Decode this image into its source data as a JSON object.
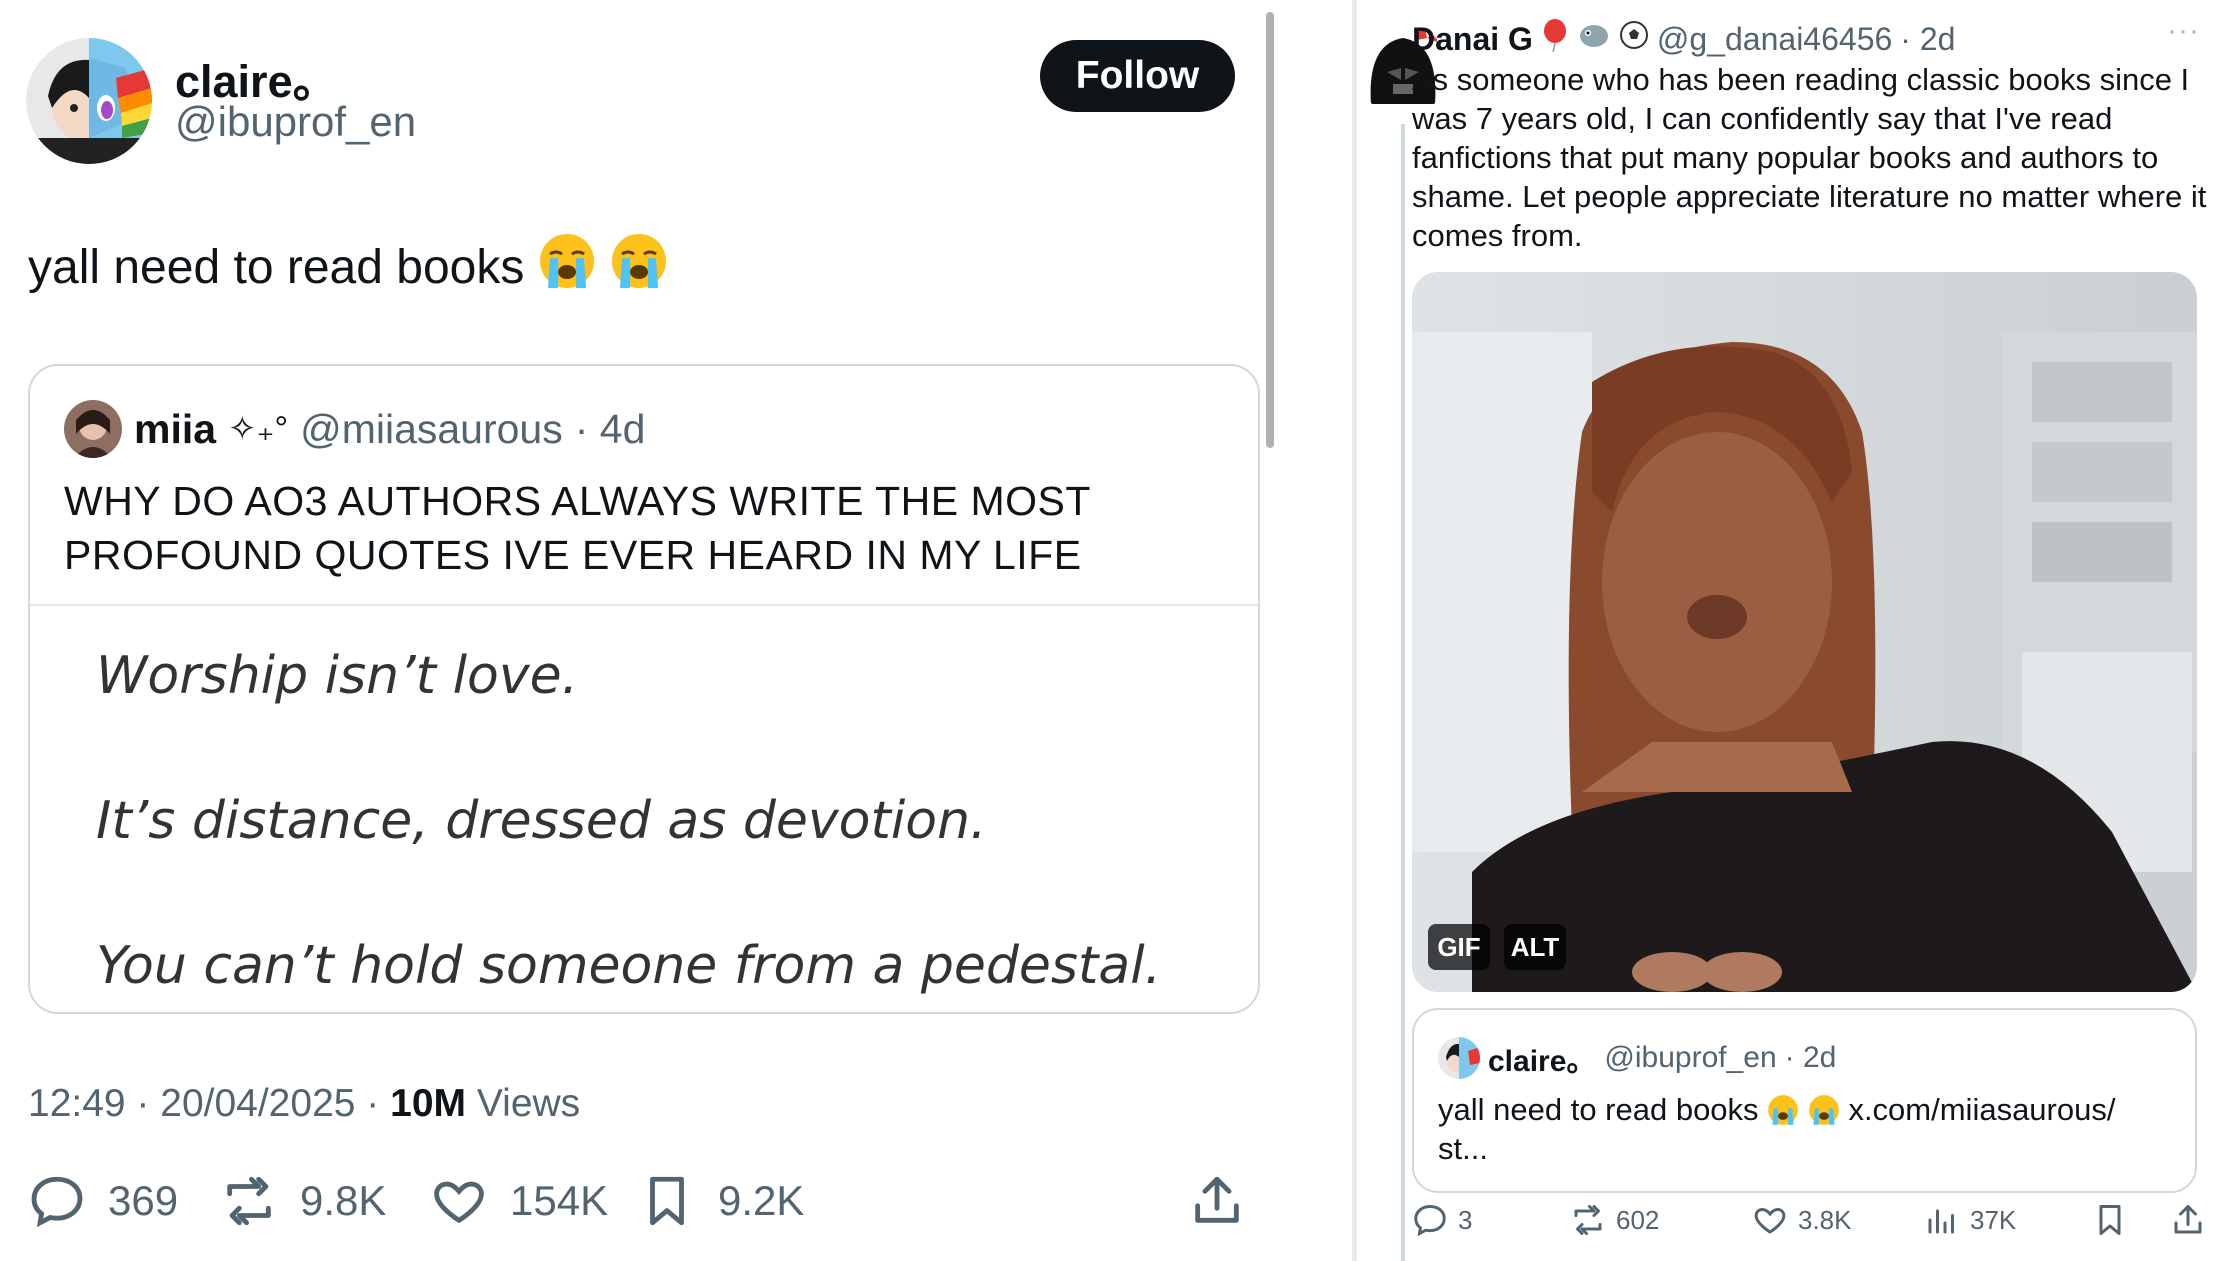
{
  "left_tweet": {
    "author_name": "claire。",
    "author_handle": "@ibuprof_en",
    "follow_label": "Follow",
    "text": "yall need to read books",
    "emojis": [
      "loudly-crying-face",
      "loudly-crying-face"
    ],
    "quoted": {
      "author_name": "miia",
      "author_decoration": "✧₊°",
      "author_handle": "@miiasaurous",
      "time": "· 4d",
      "text": "WHY DO AO3 AUTHORS ALWAYS WRITE THE MOST PROFOUND QUOTES IVE EVER HEARD IN MY LIFE",
      "image_lines": [
        "Worship isn’t love.",
        "It’s distance, dressed as devotion.",
        "You can’t hold someone from a pedestal."
      ]
    },
    "timestamp": "12:49 · 20/04/2025 ·",
    "views_count": "10M",
    "views_label": "Views",
    "actions": {
      "replies": "369",
      "reposts": "9.8K",
      "likes": "154K",
      "bookmarks": "9.2K"
    }
  },
  "right_tweet": {
    "author_name": "Danai G",
    "author_badges": [
      "balloon-icon",
      "bird-icon",
      "soccer-ball-icon"
    ],
    "author_handle": "@g_danai46456",
    "time": "· 2d",
    "more_label": "···",
    "text": "As someone who has been reading classic books since I was 7 years old, I can confidently say that I've read fanfictions that put many popular books and authors to shame. Let people appreciate literature no matter where it comes from.",
    "media": {
      "gif_label": "GIF",
      "alt_label": "ALT"
    },
    "quoted": {
      "author_name": "claire。",
      "author_handle": "@ibuprof_en",
      "time": "· 2d",
      "text": "yall need to read books",
      "link_text": "x.com/miiasaurous/",
      "link_tail": "st..."
    },
    "actions": {
      "replies": "3",
      "reposts": "602",
      "likes": "3.8K",
      "views": "37K"
    }
  },
  "colors": {
    "text": "#0f1419",
    "secondary": "#536471",
    "border": "#cfd9de",
    "follow_bg": "#0f1419"
  }
}
